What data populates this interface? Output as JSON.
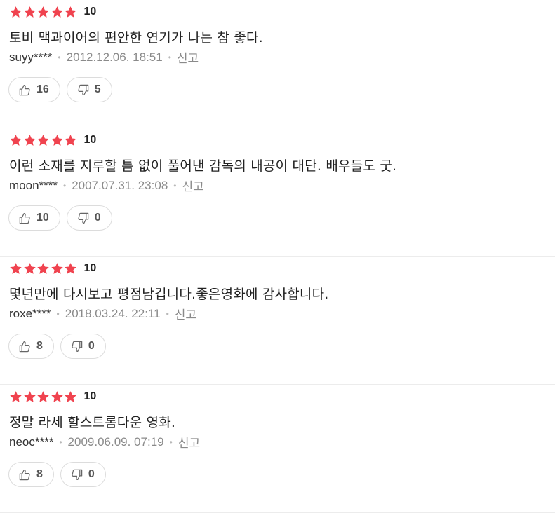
{
  "colors": {
    "star": "#f0434f",
    "icon": "#666666"
  },
  "reviews": [
    {
      "stars": 5,
      "score": "10",
      "comment": "토비 맥과이어의 편안한 연기가 나는 참 좋다.",
      "author": "suyy****",
      "date": "2012.12.06. 18:51",
      "report_label": "신고",
      "likes": "16",
      "dislikes": "5"
    },
    {
      "stars": 5,
      "score": "10",
      "comment": "이런 소재를 지루할 틈 없이 풀어낸 감독의 내공이 대단. 배우들도 굿.",
      "author": "moon****",
      "date": "2007.07.31. 23:08",
      "report_label": "신고",
      "likes": "10",
      "dislikes": "0"
    },
    {
      "stars": 5,
      "score": "10",
      "comment": "몇년만에 다시보고 평점남깁니다.좋은영화에 감사합니다.",
      "author": "roxe****",
      "date": "2018.03.24. 22:11",
      "report_label": "신고",
      "likes": "8",
      "dislikes": "0"
    },
    {
      "stars": 5,
      "score": "10",
      "comment": "정말 라세 할스트롬다운 영화.",
      "author": "neoc****",
      "date": "2009.06.09. 07:19",
      "report_label": "신고",
      "likes": "8",
      "dislikes": "0"
    }
  ],
  "icons": {
    "star": "star-icon",
    "like": "thumbs-up-icon",
    "dislike": "thumbs-down-icon"
  }
}
